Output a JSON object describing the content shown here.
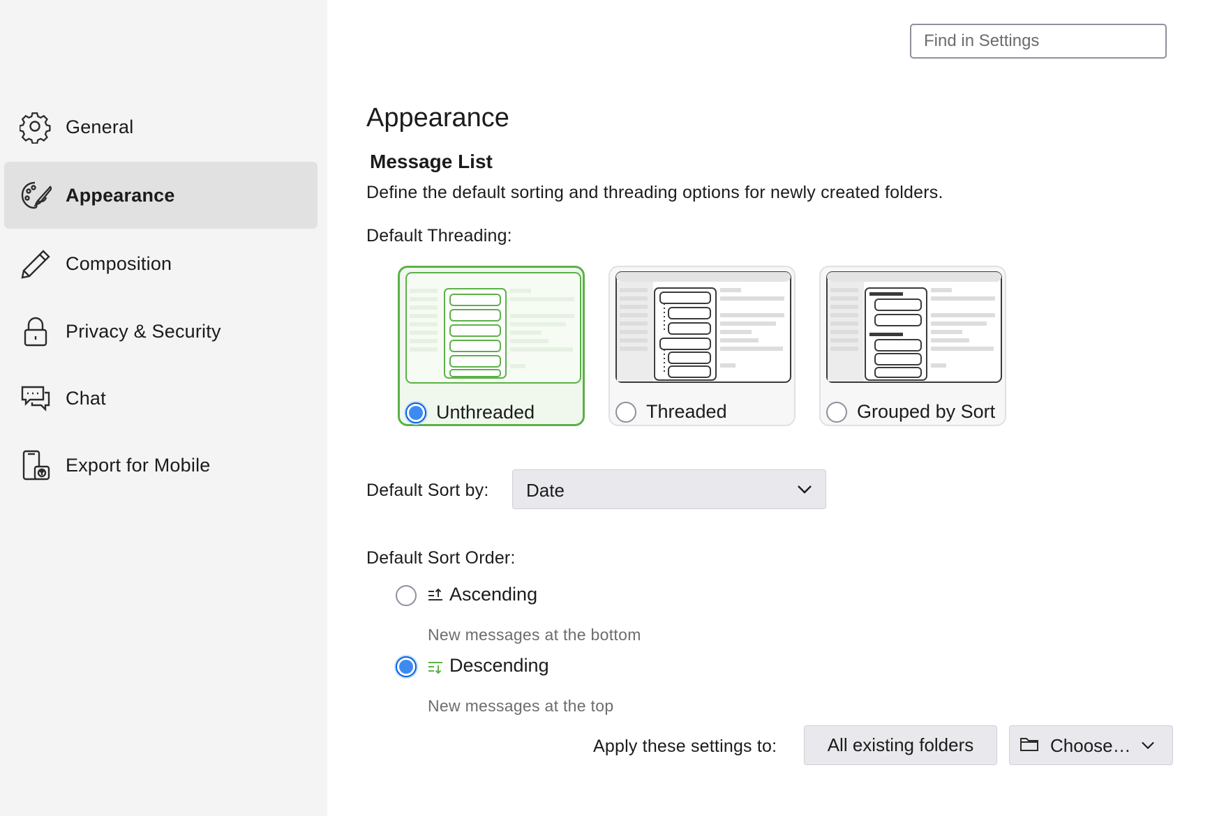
{
  "search": {
    "placeholder": "Find in Settings"
  },
  "sidebar": {
    "items": [
      {
        "label": "General",
        "icon": "gear-icon"
      },
      {
        "label": "Appearance",
        "icon": "palette-icon",
        "selected": true
      },
      {
        "label": "Composition",
        "icon": "pencil-icon"
      },
      {
        "label": "Privacy & Security",
        "icon": "lock-icon"
      },
      {
        "label": "Chat",
        "icon": "chat-bubbles-icon"
      },
      {
        "label": "Export for Mobile",
        "icon": "phone-export-icon"
      }
    ]
  },
  "main": {
    "title": "Appearance",
    "section_title": "Message List",
    "description": "Define the default sorting and threading options for newly created folders.",
    "threading": {
      "label": "Default Threading:",
      "options": [
        {
          "label": "Unthreaded",
          "selected": true
        },
        {
          "label": "Threaded",
          "selected": false
        },
        {
          "label": "Grouped by Sort",
          "selected": false
        }
      ]
    },
    "sort_by": {
      "label": "Default Sort by:",
      "value": "Date"
    },
    "sort_order": {
      "label": "Default Sort Order:",
      "options": [
        {
          "label": "Ascending",
          "description": "New messages at the bottom",
          "selected": false
        },
        {
          "label": "Descending",
          "description": "New messages at the top",
          "selected": true
        }
      ]
    },
    "apply": {
      "label": "Apply these settings to:",
      "all_folders_button": "All existing folders",
      "choose_button": "Choose…"
    }
  },
  "colors": {
    "accent_blue": "#3d8bf2",
    "selected_green": "#5bb147",
    "sidebar_bg": "#f4f4f4",
    "sidebar_selected": "#e1e1e1"
  }
}
